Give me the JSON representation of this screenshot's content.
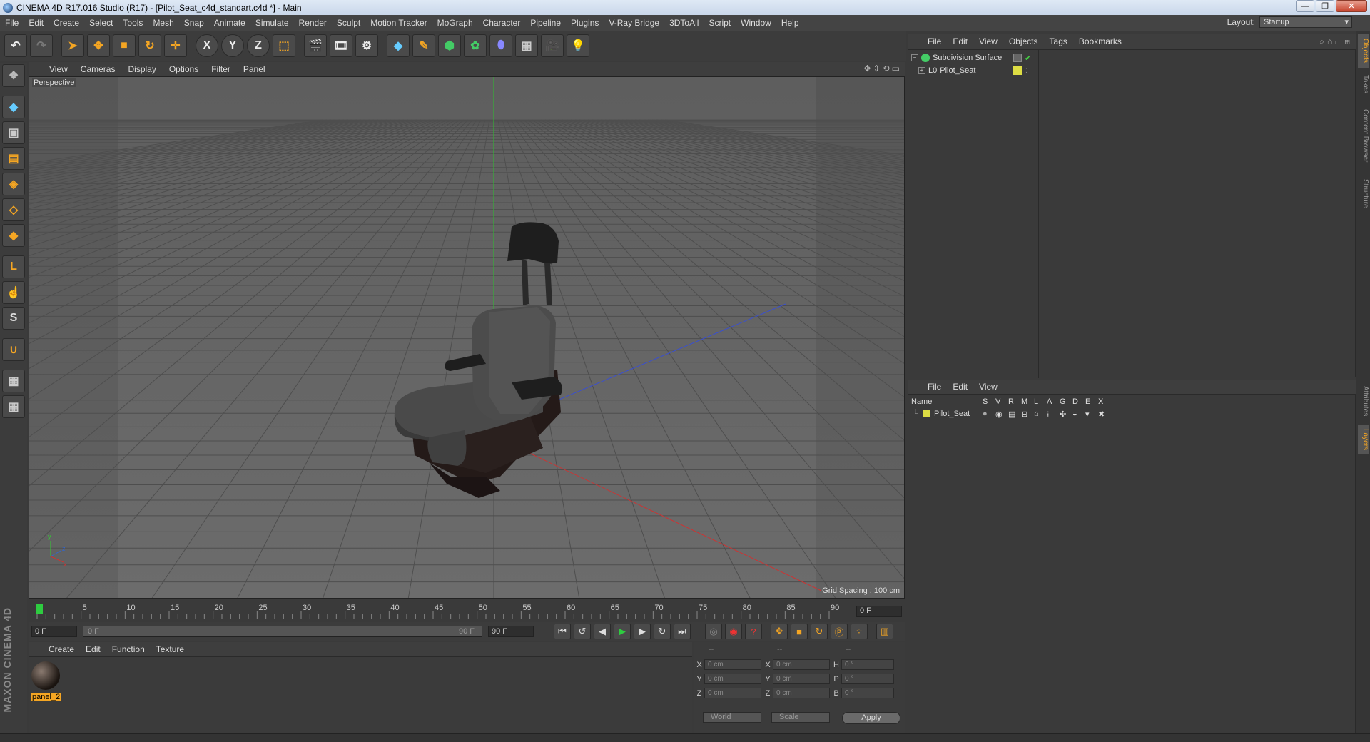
{
  "window": {
    "title": "CINEMA 4D R17.016 Studio (R17) - [Pilot_Seat_c4d_standart.c4d *] - Main",
    "minimize": "—",
    "maximize": "❐",
    "close": "✕"
  },
  "menubar": {
    "items": [
      "File",
      "Edit",
      "Create",
      "Select",
      "Tools",
      "Mesh",
      "Snap",
      "Animate",
      "Simulate",
      "Render",
      "Sculpt",
      "Motion Tracker",
      "MoGraph",
      "Character",
      "Pipeline",
      "Plugins",
      "V-Ray Bridge",
      "3DToAll",
      "Script",
      "Window",
      "Help"
    ],
    "layout_label": "Layout:",
    "layout_value": "Startup"
  },
  "toolbar": {
    "axis_x": "X",
    "axis_y": "Y",
    "axis_z": "Z"
  },
  "viewport": {
    "menu": [
      "View",
      "Cameras",
      "Display",
      "Options",
      "Filter",
      "Panel"
    ],
    "label": "Perspective",
    "grid_spacing": "Grid Spacing : 100 cm",
    "axis_y_label": "y",
    "axis_z_label": "z",
    "axis_x_label": "x"
  },
  "timeline": {
    "ticks": [
      "0",
      "5",
      "10",
      "15",
      "20",
      "25",
      "30",
      "35",
      "40",
      "45",
      "50",
      "55",
      "60",
      "65",
      "70",
      "75",
      "80",
      "85",
      "90"
    ],
    "current_frame": "0 F"
  },
  "playback": {
    "start_field": "0 F",
    "range_start": "0 F",
    "range_end": "90 F",
    "end_field": "90 F"
  },
  "material_manager": {
    "menu": [
      "Create",
      "Edit",
      "Function",
      "Texture"
    ],
    "material_name": "panel_2"
  },
  "coordinates": {
    "header": [
      "--",
      "--",
      "--"
    ],
    "rows": [
      {
        "l1": "X",
        "v1": "0 cm",
        "l2": "X",
        "v2": "0 cm",
        "l3": "H",
        "v3": "0 °"
      },
      {
        "l1": "Y",
        "v1": "0 cm",
        "l2": "Y",
        "v2": "0 cm",
        "l3": "P",
        "v3": "0 °"
      },
      {
        "l1": "Z",
        "v1": "0 cm",
        "l2": "Z",
        "v2": "0 cm",
        "l3": "B",
        "v3": "0 °"
      }
    ],
    "coord_system": "World",
    "mode": "Scale",
    "apply": "Apply"
  },
  "object_manager": {
    "menu": [
      "File",
      "Edit",
      "View",
      "Objects",
      "Tags",
      "Bookmarks"
    ],
    "objects": [
      {
        "name": "Subdivision Surface",
        "icon_color": "#44cc66"
      },
      {
        "name": "Pilot_Seat",
        "icon_color": "#dddd44"
      }
    ]
  },
  "layer_manager": {
    "menu": [
      "File",
      "Edit",
      "View"
    ],
    "columns": [
      "Name",
      "S",
      "V",
      "R",
      "M",
      "L",
      "A",
      "G",
      "D",
      "E",
      "X"
    ],
    "layer_name": "Pilot_Seat"
  },
  "side_tabs": [
    "Objects",
    "Takes",
    "Content Browser",
    "Structure",
    "Attributes",
    "Layers"
  ],
  "branding": {
    "maxon": "MAXON CINEMA 4D"
  },
  "colors": {
    "accent": "#f5a623",
    "active": "#4fa3ff"
  }
}
